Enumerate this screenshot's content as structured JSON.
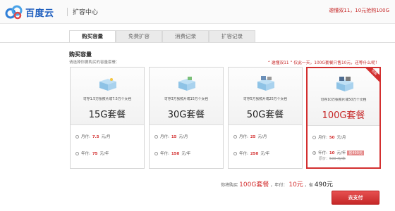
{
  "header": {
    "brand": "百度云",
    "subtitle": "扩容中心",
    "promo": "邀懂双11，10元抢购100G"
  },
  "tabs": [
    {
      "label": "购买容量",
      "active": true
    },
    {
      "label": "免费扩容",
      "active": false
    },
    {
      "label": "消费记录",
      "active": false
    },
    {
      "label": "扩容记录",
      "active": false
    }
  ],
  "section": {
    "title": "购买容量",
    "subtitle": "请选择你要购买的容量套餐：",
    "promo": "“ 邀懂双11 ”  仅此一天，100G套餐只售10元，还等什么呢！"
  },
  "cards": [
    {
      "desc": "可存1.5万张照片或7.5万个文档",
      "name": "15G套餐",
      "monthly_label": "月付:",
      "monthly_price": "7.5",
      "monthly_unit": "元/月",
      "yearly_label": "年付:",
      "yearly_price": "75",
      "yearly_unit": "元/年"
    },
    {
      "desc": "可存3万张照片或15万个文档",
      "name": "30G套餐",
      "monthly_label": "月付:",
      "monthly_price": "15",
      "monthly_unit": "元/月",
      "yearly_label": "年付:",
      "yearly_price": "150",
      "yearly_unit": "元/年"
    },
    {
      "desc": "可存5万张照片或25万个文档",
      "name": "50G套餐",
      "monthly_label": "月付:",
      "monthly_price": "25",
      "monthly_unit": "元/月",
      "yearly_label": "年付:",
      "yearly_price": "250",
      "yearly_unit": "元/年"
    },
    {
      "desc": "可存10万张照片或50万个文档",
      "name": "100G套餐",
      "monthly_label": "月付:",
      "monthly_price": "50",
      "monthly_unit": "元/月",
      "yearly_label": "年付:",
      "yearly_price": "10",
      "yearly_unit": "元/年",
      "save_badge": "省490元",
      "orig_label": "原价：",
      "orig_price": "500 元/年",
      "ribbon": "抢购"
    }
  ],
  "summary": {
    "prefix": "你将购买",
    "package": "100G套餐",
    "sep1": "，年付：",
    "price": "10元",
    "sep2": "，省",
    "saved": "490元"
  },
  "pay_button": "去支付",
  "colors": {
    "accent": "#d32f2f",
    "brand": "#1f5fbf"
  }
}
